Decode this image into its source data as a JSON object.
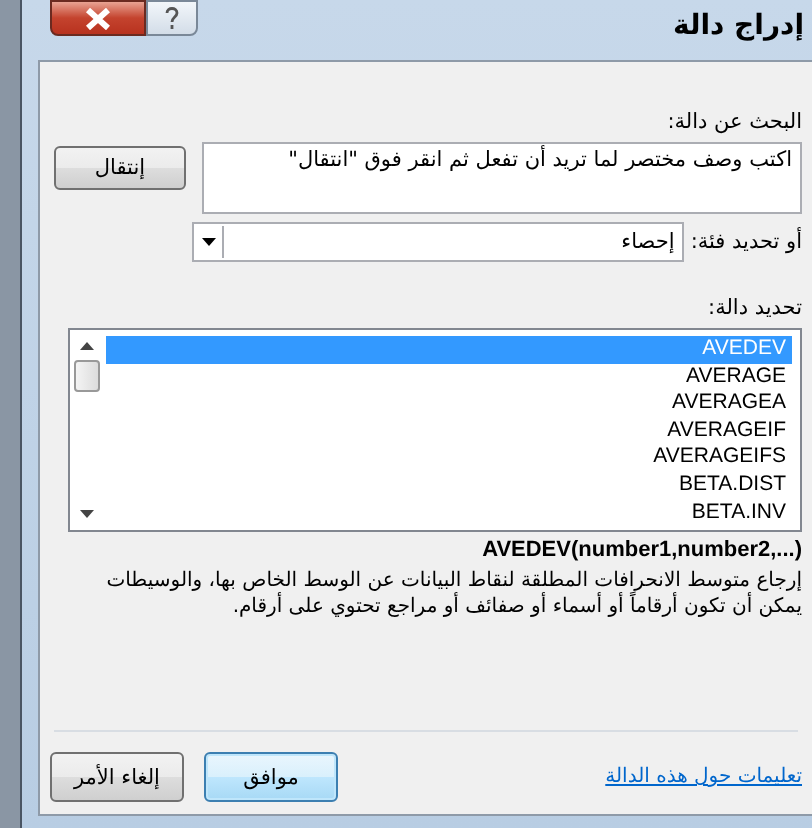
{
  "window": {
    "title": "إدراج دالة"
  },
  "search": {
    "label": "البحث عن دالة:",
    "value": "اكتب وصف مختصر لما تريد أن تفعل ثم انقر فوق \"انتقال\"",
    "button": "إنتقال"
  },
  "category": {
    "label": "أو تحديد فئة:",
    "value": "إحصاء"
  },
  "functions": {
    "label": "تحديد دالة:",
    "items": [
      {
        "name": "AVEDEV",
        "selected": true
      },
      {
        "name": "AVERAGE",
        "selected": false
      },
      {
        "name": "AVERAGEA",
        "selected": false
      },
      {
        "name": "AVERAGEIF",
        "selected": false
      },
      {
        "name": "AVERAGEIFS",
        "selected": false
      },
      {
        "name": "BETA.DIST",
        "selected": false
      },
      {
        "name": "BETA.INV",
        "selected": false
      }
    ]
  },
  "signature": "AVEDEV(number1,number2,...)",
  "description": "إرجاع متوسط الانحرافات المطلقة لنقاط البيانات عن الوسط الخاص بها، والوسيطات يمكن أن تكون أرقاماً أو أسماء أو صفائف أو مراجع تحتوي على أرقام.",
  "help_link": "تعليمات حول هذه الدالة",
  "buttons": [
    {
      "label": "موافق",
      "default": true
    },
    {
      "label": "إلغاء الأمر",
      "default": false
    }
  ]
}
